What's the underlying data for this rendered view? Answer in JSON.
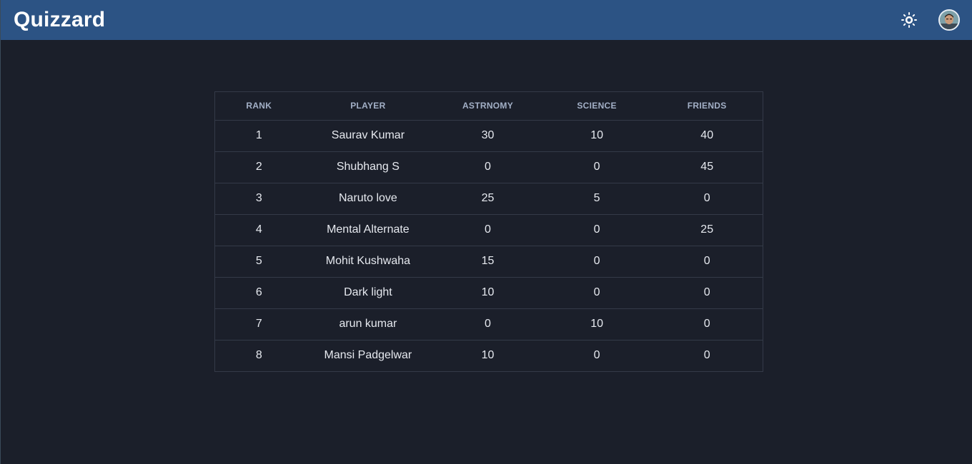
{
  "app": {
    "title": "Quizzard"
  },
  "header": {
    "theme_icon": "sun-icon",
    "avatar_icon": "user-avatar"
  },
  "leaderboard": {
    "columns": [
      "RANK",
      "PLAYER",
      "ASTRNOMY",
      "SCIENCE",
      "FRIENDS"
    ],
    "rows": [
      [
        "1",
        "Saurav Kumar",
        "30",
        "10",
        "40"
      ],
      [
        "2",
        "Shubhang S",
        "0",
        "0",
        "45"
      ],
      [
        "3",
        "Naruto love",
        "25",
        "5",
        "0"
      ],
      [
        "4",
        "Mental Alternate",
        "0",
        "0",
        "25"
      ],
      [
        "5",
        "Mohit Kushwaha",
        "15",
        "0",
        "0"
      ],
      [
        "6",
        "Dark light",
        "10",
        "0",
        "0"
      ],
      [
        "7",
        "arun kumar",
        "0",
        "10",
        "0"
      ],
      [
        "8",
        "Mansi Padgelwar",
        "10",
        "0",
        "0"
      ]
    ]
  },
  "colors": {
    "navbar": "#2c5384",
    "background": "#1b1f2a",
    "border": "#343a48",
    "header_text": "#a3b0c7"
  }
}
